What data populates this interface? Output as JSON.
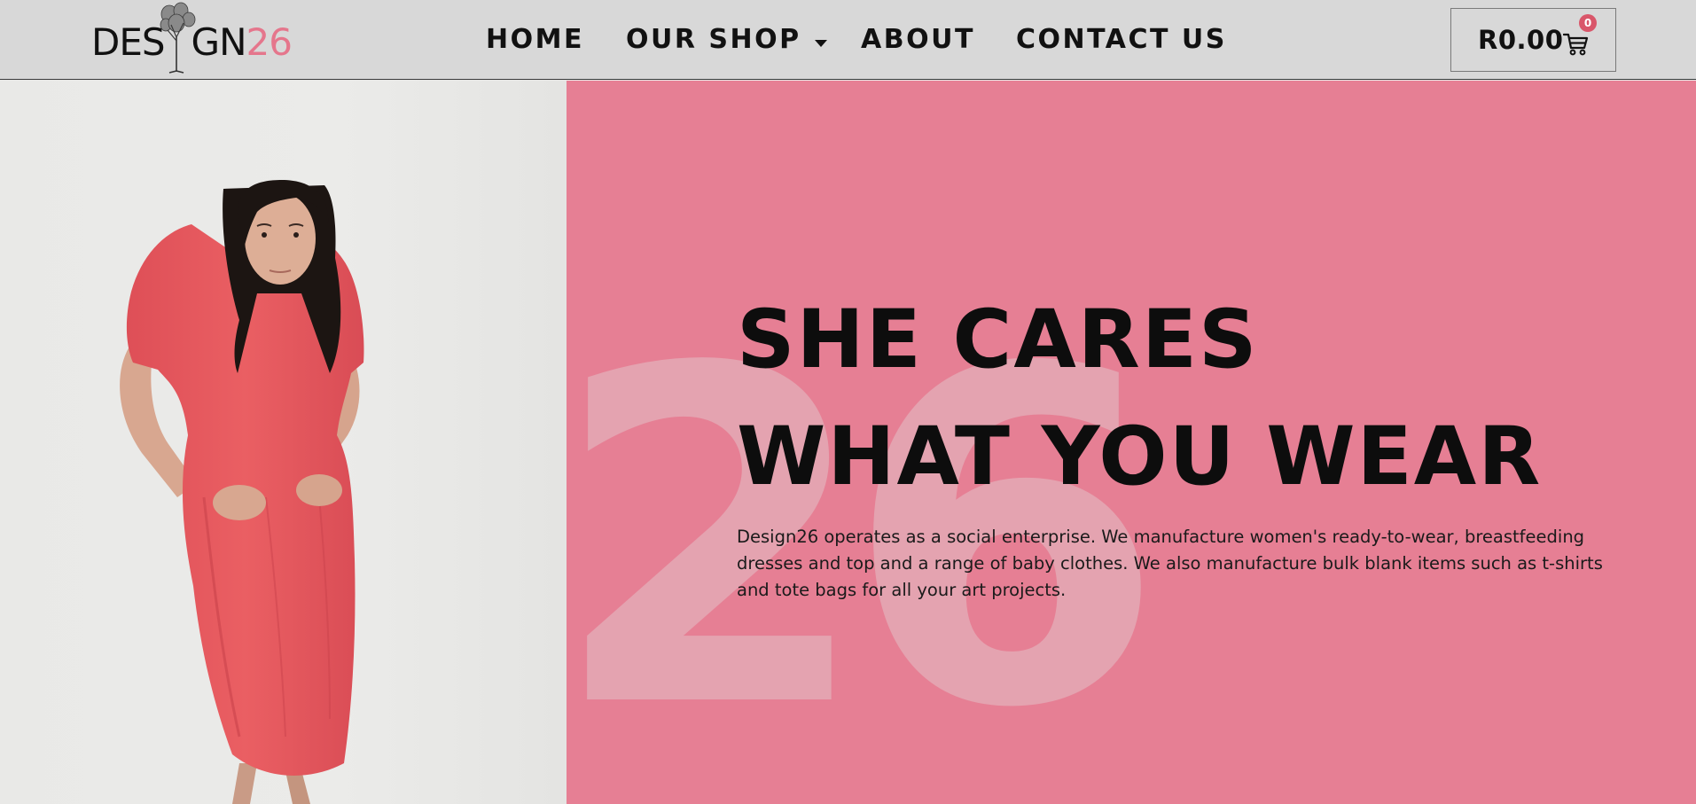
{
  "brand": {
    "logo_dark": "DES",
    "logo_dark_2": "GN",
    "logo_pink": "26"
  },
  "nav": {
    "items": [
      {
        "label": "HOME"
      },
      {
        "label": "OUR SHOP"
      },
      {
        "label": "ABOUT"
      },
      {
        "label": "CONTACT US"
      }
    ]
  },
  "cart": {
    "total": "R0.00",
    "count": "0"
  },
  "hero": {
    "numeral": "26",
    "headline_line1": "SHE CARES",
    "headline_line2": "WHAT YOU WEAR",
    "body": "Design26 operates as a social enterprise.  We manufacture women's ready-to-wear, breastfeeding dresses and top and a range of baby clothes.  We also manufacture bulk blank items such as t-shirts and tote bags for all your art projects."
  },
  "colors": {
    "header_bg": "#d8d8d8",
    "hero_pink": "#e67f94",
    "numeral_pink": "#e4a3b0",
    "logo_pink": "#e5768c",
    "badge_red": "#d9566a",
    "dress_coral": "#e7585e"
  },
  "icons": {
    "cart": "shopping-cart-icon",
    "caret": "chevron-down-icon"
  }
}
